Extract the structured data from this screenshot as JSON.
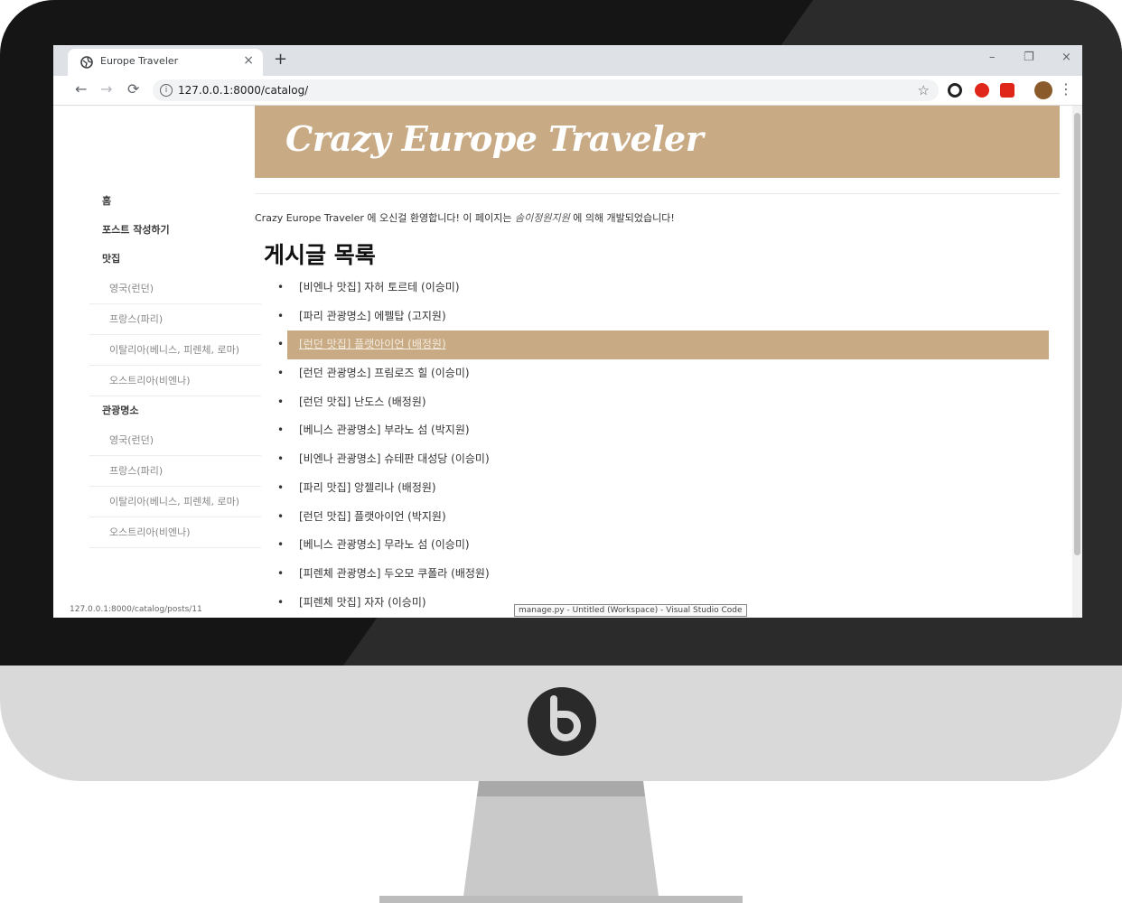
{
  "browser": {
    "tab_title": "Europe Traveler",
    "tab_close": "×",
    "new_tab": "+",
    "url": "127.0.0.1:8000/catalog/",
    "window_controls": {
      "minimize": "–",
      "restore": "❐",
      "close": "×"
    },
    "nav": {
      "back": "←",
      "forward": "→",
      "reload": "⟳"
    },
    "star": "☆",
    "menu": "⋮"
  },
  "site": {
    "title": "Crazy Europe Traveler",
    "welcome_prefix": "Crazy Europe Traveler 에 오신걸 환영합니다! 이 페이지는 ",
    "welcome_dev": "솜이정원지원",
    "welcome_suffix": " 에 의해 개발되었습니다!"
  },
  "sidebar": {
    "home": "홈",
    "write_post": "포스트 작성하기",
    "food": {
      "label": "맛집",
      "items": [
        "영국(런던)",
        "프랑스(파리)",
        "이탈리아(베니스, 피렌체, 로마)",
        "오스트리아(비엔나)"
      ]
    },
    "sights": {
      "label": "관광명소",
      "items": [
        "영국(런던)",
        "프랑스(파리)",
        "이탈리아(베니스, 피렌체, 로마)",
        "오스트리아(비엔나)"
      ]
    }
  },
  "main": {
    "list_title": "게시글 목록",
    "bullet": "•",
    "posts": [
      "[비엔나 맛집] 자허 토르테 (이승미)",
      "[파리 관광명소] 에펠탑 (고지원)",
      "[런던 맛집] 플랫아이언 (배정원)",
      "[런던 관광명소] 프림로즈 힐 (이승미)",
      "[런던 맛집] 난도스 (배정원)",
      "[베니스 관광명소] 부라노 섬 (박지원)",
      "[비엔나 관광명소] 슈테판 대성당 (이승미)",
      "[파리 맛집] 앙젤리나 (배정원)",
      "[런던 맛집] 플랫아이언 (박지원)",
      "[베니스 관광명소] 무라노 섬 (이승미)",
      "[피렌체 관광명소] 두오모 쿠폴라 (배정원)",
      "[피렌체 맛집] 자자 (이승미)"
    ],
    "highlighted_index": 2
  },
  "status_url": "127.0.0.1:8000/catalog/posts/11",
  "taskbar_tooltip": "manage.py - Untitled (Workspace) - Visual Studio Code",
  "colors": {
    "accent": "#c8aa84",
    "bezel": "#151515",
    "chin": "#d9d9d9"
  }
}
